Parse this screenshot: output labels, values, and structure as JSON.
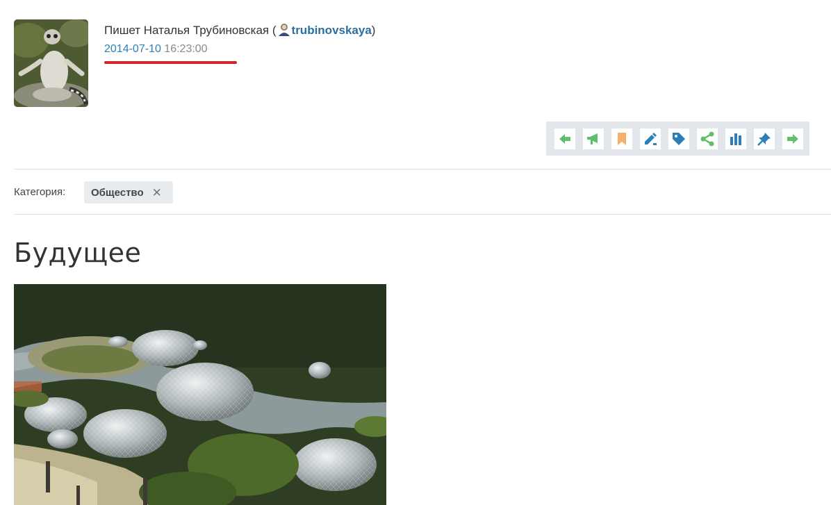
{
  "post": {
    "author_prefix": "Пишет Наталья Трубиновская (",
    "username": "trubinovskaya",
    "author_suffix": ")",
    "date": "2014-07-10",
    "time": "16:23:00",
    "title": "Будущее"
  },
  "category": {
    "label": "Категория:",
    "tag": "Общество",
    "remove_glyph": "✕"
  },
  "toolbar": {
    "buttons": [
      {
        "icon": "arrow-left-icon",
        "color": "#5fbf6a"
      },
      {
        "icon": "megaphone-icon",
        "color": "#5fbf6a"
      },
      {
        "icon": "bookmark-icon",
        "color": "#f4b06e"
      },
      {
        "icon": "pencil-icon",
        "color": "#2c7fb8"
      },
      {
        "icon": "tag-icon",
        "color": "#2c7fb8"
      },
      {
        "icon": "share-icon",
        "color": "#5fbf6a"
      },
      {
        "icon": "stats-icon",
        "color": "#2c7fb8"
      },
      {
        "icon": "pin-icon",
        "color": "#2c7fb8"
      },
      {
        "icon": "arrow-right-icon",
        "color": "#5fbf6a"
      }
    ]
  },
  "colors": {
    "link": "#2a6fa0",
    "date": "#2c7fb8",
    "underline": "#d3242b",
    "toolbar_bg": "#e3e6ea"
  }
}
